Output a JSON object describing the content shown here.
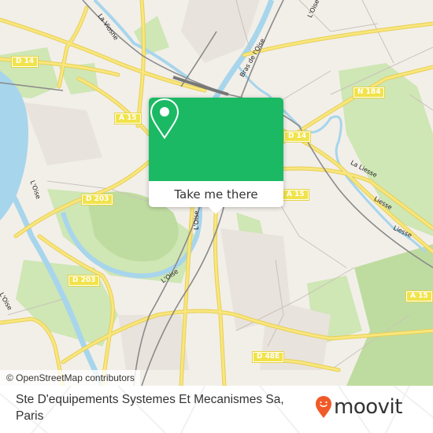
{
  "map": {
    "road_labels": [
      {
        "id": "d14-west",
        "text": "D 14"
      },
      {
        "id": "a15-west",
        "text": "A 15"
      },
      {
        "id": "n184",
        "text": "N 184"
      },
      {
        "id": "d14-east",
        "text": "D 14"
      },
      {
        "id": "d203-north",
        "text": "D 203"
      },
      {
        "id": "a15-center",
        "text": "A 15"
      },
      {
        "id": "d203-south",
        "text": "D 203"
      },
      {
        "id": "a15-east",
        "text": "A 15"
      },
      {
        "id": "d48e",
        "text": "D 48E"
      }
    ],
    "water_labels": [
      {
        "id": "la-viosne",
        "text": "La Viosne"
      },
      {
        "id": "bras-de-loise",
        "text": "Bras de l'Oise"
      },
      {
        "id": "loise-top",
        "text": "L'Oise"
      },
      {
        "id": "loise-west",
        "text": "L'Oise"
      },
      {
        "id": "loise-center-v",
        "text": "L'Oise"
      },
      {
        "id": "loise-center",
        "text": "L'Oise"
      },
      {
        "id": "loise-sw",
        "text": "L'Oise"
      },
      {
        "id": "la-liesse",
        "text": "La Liesse"
      },
      {
        "id": "liesse-1",
        "text": "Liesse"
      },
      {
        "id": "liesse-2",
        "text": "Liesse"
      }
    ],
    "colors": {
      "background": "#f2efe9",
      "water": "#a7d5ec",
      "park": "#c8e2ad",
      "road": "#f6e27a",
      "rail": "#888888",
      "accent": "#1bb964"
    }
  },
  "popup": {
    "icon": "location-pin-icon",
    "button_label": "Take me there"
  },
  "attribution": "© OpenStreetMap contributors",
  "footer": {
    "place_name": "Ste D'equipements Systemes Et Mecanismes Sa, Paris",
    "logo_text": "moovit",
    "logo_color": "#f05a28"
  }
}
